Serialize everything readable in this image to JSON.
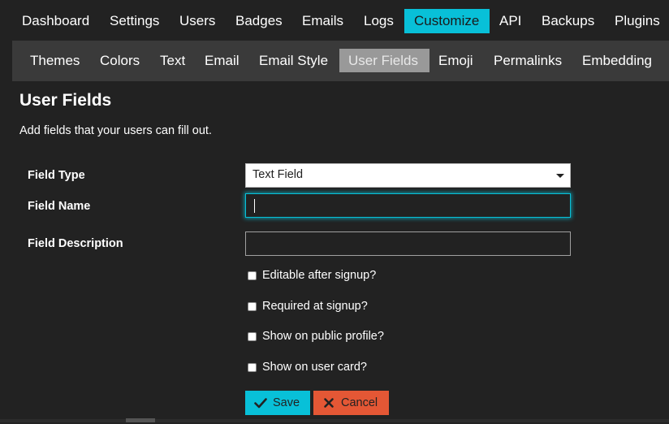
{
  "top_nav": {
    "items": [
      "Dashboard",
      "Settings",
      "Users",
      "Badges",
      "Emails",
      "Logs",
      "Customize",
      "API",
      "Backups",
      "Plugins"
    ],
    "active": "Customize"
  },
  "sub_nav": {
    "items": [
      "Themes",
      "Colors",
      "Text",
      "Email",
      "Email Style",
      "User Fields",
      "Emoji",
      "Permalinks",
      "Embedding"
    ],
    "active": "User Fields"
  },
  "page": {
    "title": "User Fields",
    "description": "Add fields that your users can fill out."
  },
  "form": {
    "field_type_label": "Field Type",
    "field_type_value": "Text Field",
    "field_name_label": "Field Name",
    "field_name_value": "",
    "field_description_label": "Field Description",
    "field_description_value": "",
    "checkboxes": [
      {
        "label": "Editable after signup?",
        "checked": false
      },
      {
        "label": "Required at signup?",
        "checked": false
      },
      {
        "label": "Show on public profile?",
        "checked": false
      },
      {
        "label": "Show on user card?",
        "checked": false
      }
    ],
    "save_label": "Save",
    "cancel_label": "Cancel",
    "save_icon": "check-icon",
    "cancel_icon": "times-icon"
  },
  "colors": {
    "accent": "#08c0d8",
    "danger": "#e45735",
    "background": "#222222"
  }
}
